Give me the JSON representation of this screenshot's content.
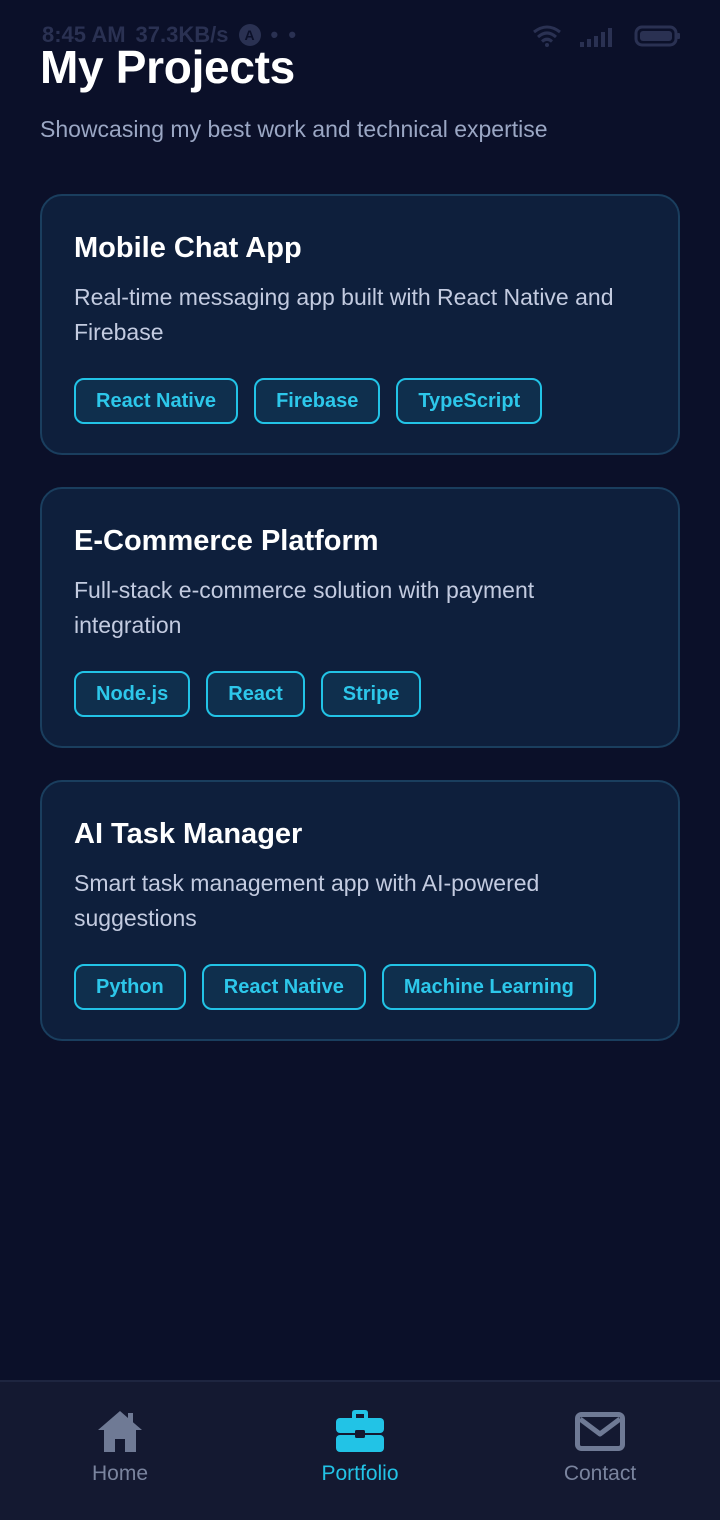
{
  "status_bar": {
    "time": "8:45 AM",
    "speed": "37.3KB/s",
    "a_badge": "A",
    "dots": "• •"
  },
  "header": {
    "title": "My Projects",
    "subtitle": "Showcasing my best work and technical expertise"
  },
  "projects": [
    {
      "title": "Mobile Chat App",
      "description": "Real-time messaging app built with React Native and Firebase",
      "tags": [
        "React Native",
        "Firebase",
        "TypeScript"
      ]
    },
    {
      "title": "E-Commerce Platform",
      "description": "Full-stack e-commerce solution with payment integration",
      "tags": [
        "Node.js",
        "React",
        "Stripe"
      ]
    },
    {
      "title": "AI Task Manager",
      "description": "Smart task management app with AI-powered suggestions",
      "tags": [
        "Python",
        "React Native",
        "Machine Learning"
      ]
    }
  ],
  "nav": {
    "items": [
      {
        "label": "Home",
        "icon": "home-icon",
        "active": false
      },
      {
        "label": "Portfolio",
        "icon": "briefcase-icon",
        "active": true
      },
      {
        "label": "Contact",
        "icon": "mail-icon",
        "active": false
      }
    ]
  },
  "colors": {
    "background": "#0b1029",
    "card": "#0e1f3c",
    "accent": "#22c3e6",
    "muted": "#7a849e"
  }
}
